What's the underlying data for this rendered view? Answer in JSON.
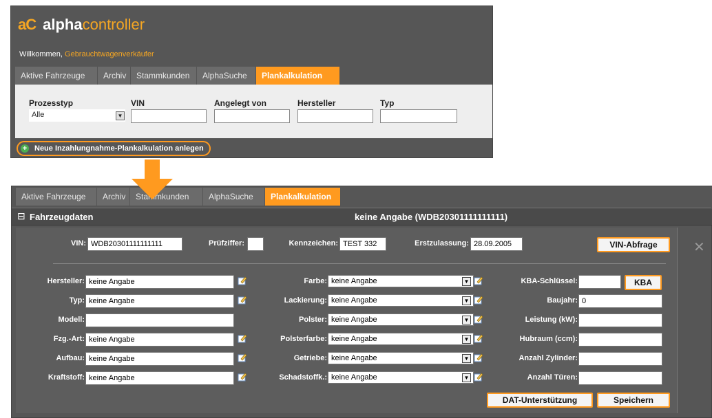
{
  "top": {
    "logo_icon": "aC",
    "logo_bold": "alpha",
    "logo_light": "controller",
    "welcome_prefix": "Willkommen,",
    "welcome_user": "Gebrauchtwagenverkäufer",
    "tabs": [
      {
        "label": "Aktive Fahrzeuge"
      },
      {
        "label": "Archiv"
      },
      {
        "label": "Stammkunden"
      },
      {
        "label": "AlphaSuche"
      },
      {
        "label": "Plankalkulation",
        "active": true
      }
    ],
    "filters": {
      "prozesstyp_label": "Prozesstyp",
      "prozesstyp_value": "Alle",
      "vin_label": "VIN",
      "angelegt_label": "Angelegt von",
      "hersteller_label": "Hersteller",
      "typ_label": "Typ"
    },
    "new_button": "Neue Inzahlungnahme-Plankalkulation anlegen"
  },
  "bottom": {
    "tabs": [
      {
        "label": "Aktive Fahrzeuge"
      },
      {
        "label": "Archiv"
      },
      {
        "label": "Stammkunden"
      },
      {
        "label": "AlphaSuche"
      },
      {
        "label": "Plankalkulation",
        "active": true
      }
    ],
    "section_toggle": "⊟",
    "section_title": "Fahrzeugdaten",
    "vehicle_title": "keine Angabe (WDB20301111111111)",
    "close_glyph": "✕",
    "row1": {
      "vin_label": "VIN:",
      "vin_value": "WDB20301111111111",
      "pruef_label": "Prüfziffer:",
      "pruef_value": "",
      "kennzeichen_label": "Kennzeichen:",
      "kennzeichen_value": "TEST 332",
      "erstzulassung_label": "Erstzulassung:",
      "erstzulassung_value": "28.09.2005",
      "vin_button": "VIN-Abfrage"
    },
    "left_fields": [
      {
        "label": "Hersteller:",
        "value": "keine Angabe",
        "edit": true
      },
      {
        "label": "Typ:",
        "value": "keine Angabe",
        "edit": true
      },
      {
        "label": "Modell:",
        "value": "",
        "edit": false
      },
      {
        "label": "Fzg.-Art:",
        "value": "keine Angabe",
        "edit": true
      },
      {
        "label": "Aufbau:",
        "value": "keine Angabe",
        "edit": true
      },
      {
        "label": "Kraftstoff:",
        "value": "keine Angabe",
        "edit": true
      }
    ],
    "mid_fields": [
      {
        "label": "Farbe:",
        "value": "keine Angabe"
      },
      {
        "label": "Lackierung:",
        "value": "keine Angabe"
      },
      {
        "label": "Polster:",
        "value": "keine Angabe"
      },
      {
        "label": "Polsterfarbe:",
        "value": "keine Angabe"
      },
      {
        "label": "Getriebe:",
        "value": "keine Angabe"
      },
      {
        "label": "Schadstoffk.:",
        "value": "keine Angabe"
      }
    ],
    "right_fields": [
      {
        "label": "KBA-Schlüssel:",
        "value": ""
      },
      {
        "label": "Baujahr:",
        "value": "0"
      },
      {
        "label": "Leistung (kW):",
        "value": ""
      },
      {
        "label": "Hubraum (ccm):",
        "value": ""
      },
      {
        "label": "Anzahl Zylinder:",
        "value": ""
      },
      {
        "label": "Anzahl Türen:",
        "value": ""
      }
    ],
    "kba_button": "KBA",
    "dat_button": "DAT-Unterstützung",
    "save_button": "Speichern"
  },
  "colors": {
    "accent": "#ff9a1f",
    "panel": "#565656",
    "tab": "#6b6b6b"
  }
}
